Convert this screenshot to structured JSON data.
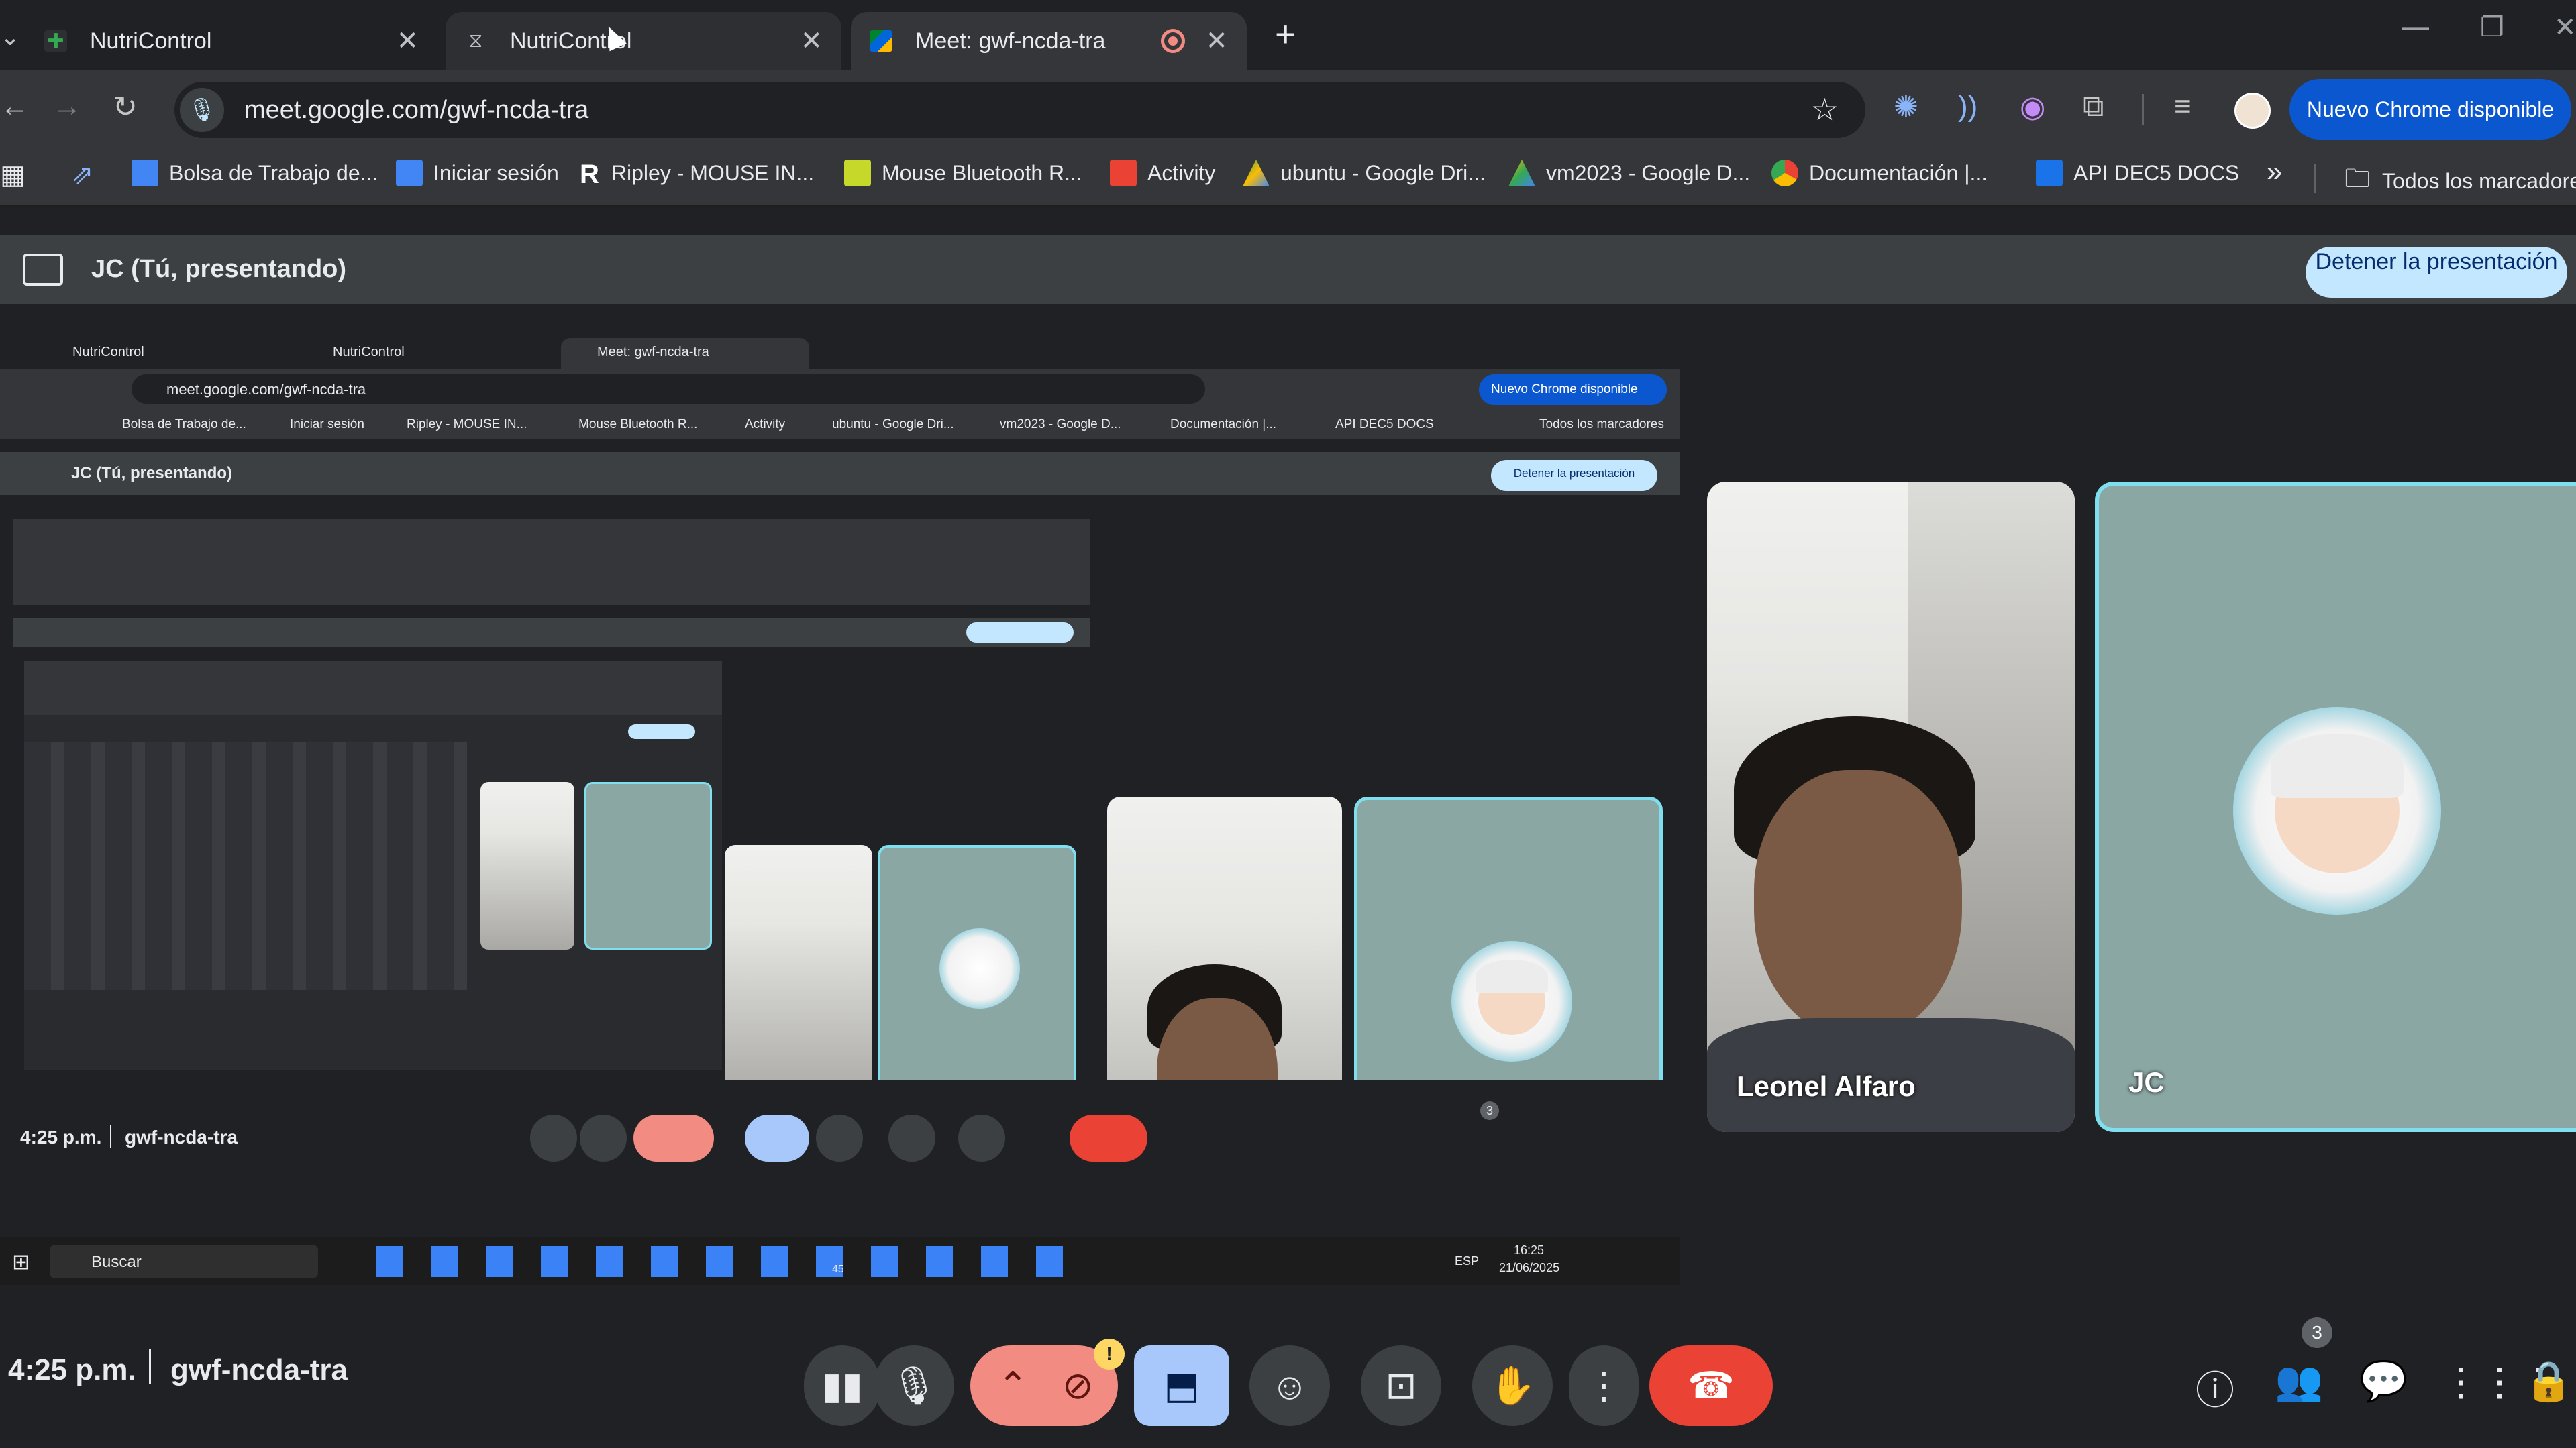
{
  "tabs": [
    {
      "title": "NutriControl",
      "active": false
    },
    {
      "title": "NutriControl",
      "active": false
    },
    {
      "title": "Meet: gwf-ncda-tra",
      "active": true
    }
  ],
  "new_tab": "+",
  "address": {
    "url": "meet.google.com/gwf-ncda-tra"
  },
  "update_button": "Nuevo Chrome disponible",
  "bookmarks": [
    {
      "label": "Bolsa de Trabajo de...",
      "color": "#4285f4"
    },
    {
      "label": "Iniciar sesión",
      "color": "#4285f4"
    },
    {
      "label": "Ripley - MOUSE IN...",
      "color": "#ffffff"
    },
    {
      "label": "Mouse Bluetooth R...",
      "color": "#c6d82a"
    },
    {
      "label": "Activity",
      "color": "#ea4335"
    },
    {
      "label": "ubuntu - Google Dri...",
      "color": "#34a853"
    },
    {
      "label": "vm2023 - Google D...",
      "color": "#fbbc04"
    },
    {
      "label": "Documentación |...",
      "color": "#ea4335"
    },
    {
      "label": "API DEC5 DOCS",
      "color": "#1a73e8"
    }
  ],
  "bookmarks_overflow": "»",
  "all_bookmarks": "Todos los marcadores",
  "presenting": {
    "label": "JC (Tú, presentando)",
    "stop_button": "Detener la presentación"
  },
  "nested": {
    "tabs": [
      "NutriControl",
      "NutriControl",
      "Meet: gwf-ncda-tra"
    ],
    "url": "meet.google.com/gwf-ncda-tra",
    "update_button": "Nuevo Chrome disponible",
    "bookmarks": [
      "Bolsa de Trabajo de...",
      "Iniciar sesión",
      "Ripley - MOUSE IN...",
      "Mouse Bluetooth R...",
      "Activity",
      "ubuntu - Google Dri...",
      "vm2023 - Google D...",
      "Documentación |...",
      "API DEC5 DOCS"
    ],
    "all_bookmarks": "Todos los marcadores",
    "presenting": "JC (Tú, presentando)",
    "stop_button": "Detener la presentación",
    "clock": "4:25 p.m.",
    "meet_code": "gwf-ncda-tra",
    "search": "Buscar",
    "participants_badge": "3",
    "tray_lang": "ESP",
    "tray_time": "16:25",
    "tray_date": "21/06/2025",
    "whatsapp_badge": "45"
  },
  "participants": [
    {
      "name": "Leonel Alfaro"
    },
    {
      "name": "JC"
    }
  ],
  "controls": {
    "clock": "4:25 p.m.",
    "meet_code": "gwf-ncda-tra",
    "participants_badge": "3",
    "warning_badge": "!"
  }
}
